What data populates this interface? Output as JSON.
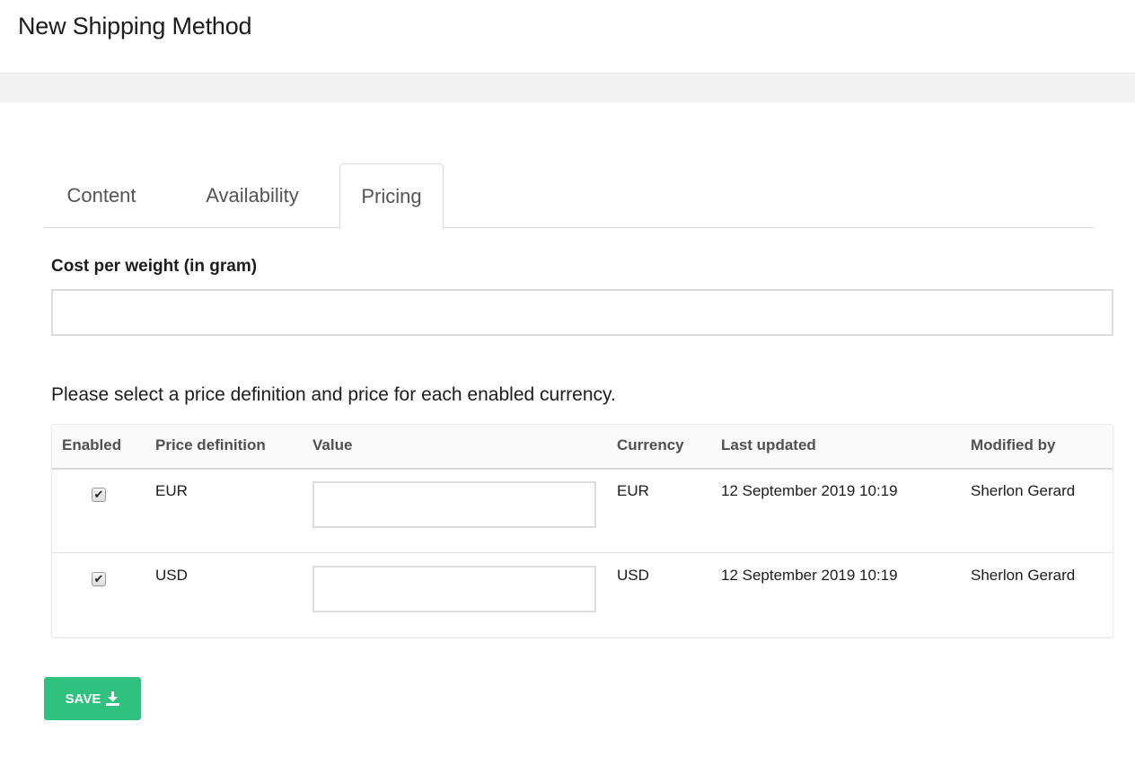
{
  "header": {
    "title": "New Shipping Method"
  },
  "tabs": [
    {
      "label": "Content",
      "active": false
    },
    {
      "label": "Availability",
      "active": false
    },
    {
      "label": "Pricing",
      "active": true
    }
  ],
  "pricing": {
    "cost_label": "Cost per weight (in gram)",
    "cost_value": "",
    "instruction": "Please select a price definition and price for each enabled currency.",
    "table": {
      "columns": [
        "Enabled",
        "Price definition",
        "Value",
        "Currency",
        "Last updated",
        "Modified by"
      ],
      "rows": [
        {
          "enabled": true,
          "price_definition": "EUR",
          "value": "",
          "currency": "EUR",
          "last_updated": "12 September 2019 10:19",
          "modified_by": "Sherlon Gerard"
        },
        {
          "enabled": true,
          "price_definition": "USD",
          "value": "",
          "currency": "USD",
          "last_updated": "12 September 2019 10:19",
          "modified_by": "Sherlon Gerard"
        }
      ]
    }
  },
  "actions": {
    "save_label": "SAVE",
    "save_icon": "download-icon",
    "save_color": "#2ec27e"
  }
}
